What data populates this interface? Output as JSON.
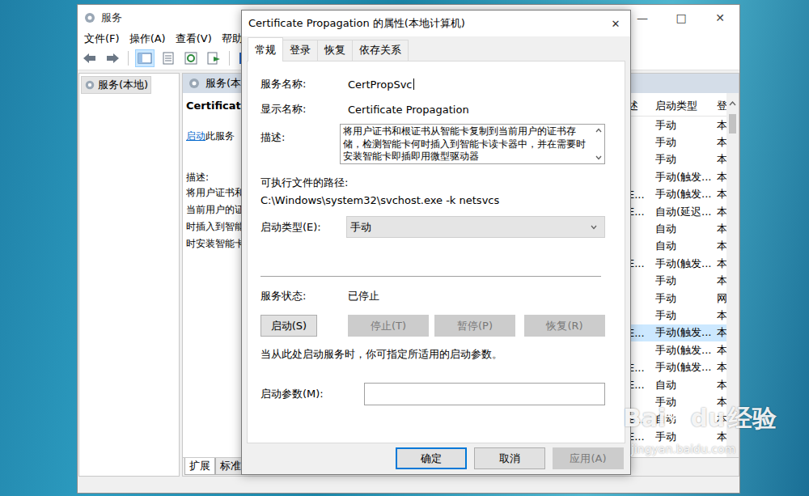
{
  "services_window": {
    "title": "服务",
    "controls": [
      "—",
      "□",
      "✕"
    ],
    "menu": [
      "文件(F)",
      "操作(A)",
      "查看(V)",
      "帮助"
    ],
    "tree": [
      {
        "label": "服务(本地)",
        "selected": true
      }
    ],
    "panel_header": "服务(本",
    "detail": {
      "name": "Certificate",
      "link": "启动",
      "link_suffix": "此服务",
      "description_label": "描述:",
      "description_lines": [
        "将用户证书和",
        "当前用户的证",
        "时插入到智能",
        "时安装智能卡"
      ]
    },
    "columns": [
      "述",
      "启动类型",
      "登"
    ],
    "rows": [
      {
        "description": "",
        "startup": "手动",
        "logon": "本",
        "selected": false
      },
      {
        "description": "",
        "startup": "手动",
        "logon": "本",
        "selected": false
      },
      {
        "description": "",
        "startup": "手动",
        "logon": "本",
        "selected": false
      },
      {
        "description": "",
        "startup": "手动(触发...",
        "logon": "本",
        "selected": false
      },
      {
        "description": "E...",
        "startup": "手动(触发...",
        "logon": "本",
        "selected": false
      },
      {
        "description": "E...",
        "startup": "自动(延迟...",
        "logon": "本",
        "selected": false
      },
      {
        "description": "",
        "startup": "自动",
        "logon": "本",
        "selected": false
      },
      {
        "description": "",
        "startup": "自动",
        "logon": "本",
        "selected": false
      },
      {
        "description": "E...",
        "startup": "手动(触发...",
        "logon": "本",
        "selected": false
      },
      {
        "description": "",
        "startup": "手动",
        "logon": "本",
        "selected": false
      },
      {
        "description": "",
        "startup": "手动",
        "logon": "网",
        "selected": false
      },
      {
        "description": "",
        "startup": "手动",
        "logon": "本",
        "selected": false
      },
      {
        "description": "E...",
        "startup": "手动(触发...",
        "logon": "本",
        "selected": true
      },
      {
        "description": "",
        "startup": "手动(触发...",
        "logon": "本",
        "selected": false
      },
      {
        "description": "E...",
        "startup": "手动(触发...",
        "logon": "本",
        "selected": false
      },
      {
        "description": "E...",
        "startup": "自动",
        "logon": "本",
        "selected": false
      },
      {
        "description": "",
        "startup": "手动",
        "logon": "本",
        "selected": false
      },
      {
        "description": "E...",
        "startup": "自动",
        "logon": "本",
        "selected": false
      },
      {
        "description": "E...",
        "startup": "手动",
        "logon": "本",
        "selected": false
      }
    ],
    "bottom_tabs": [
      {
        "label": "扩展",
        "selected": true
      },
      {
        "label": "标准",
        "selected": false
      }
    ]
  },
  "dialog": {
    "title": "Certificate Propagation 的属性(本地计算机)",
    "close": "✕",
    "tabs": [
      {
        "label": "常规",
        "selected": true
      },
      {
        "label": "登录",
        "selected": false
      },
      {
        "label": "恢复",
        "selected": false
      },
      {
        "label": "依存关系",
        "selected": false
      }
    ],
    "service_name_label": "服务名称:",
    "service_name": "CertPropSvc",
    "display_name_label": "显示名称:",
    "display_name": "Certificate Propagation",
    "description_label": "描述:",
    "description": "将用户证书和根证书从智能卡复制到当前用户的证书存储，检测智能卡何时插入到智能卡读卡器中，并在需要时安装智能卡即插即用微型驱动器",
    "path_label": "可执行文件的路径:",
    "path": "C:\\Windows\\system32\\svchost.exe -k netsvcs",
    "startup_label": "启动类型(E):",
    "startup": "手动",
    "status_label": "服务状态:",
    "status": "已停止",
    "control_buttons": [
      {
        "label": "启动(S)",
        "disabled": false
      },
      {
        "label": "停止(T)",
        "disabled": true
      },
      {
        "label": "暂停(P)",
        "disabled": true
      },
      {
        "label": "恢复(R)",
        "disabled": true
      }
    ],
    "hint": "当从此处启动服务时，你可指定所适用的启动参数。",
    "params_label": "启动参数(M):",
    "params_value": "",
    "footer_buttons": [
      {
        "label": "确定",
        "default": true,
        "disabled": false
      },
      {
        "label": "取消",
        "default": false,
        "disabled": false
      },
      {
        "label": "应用(A)",
        "default": false,
        "disabled": true
      }
    ]
  },
  "watermark": {
    "parts": [
      "Bai",
      "du",
      "经验"
    ],
    "url": "jingyan.baidu.com"
  }
}
